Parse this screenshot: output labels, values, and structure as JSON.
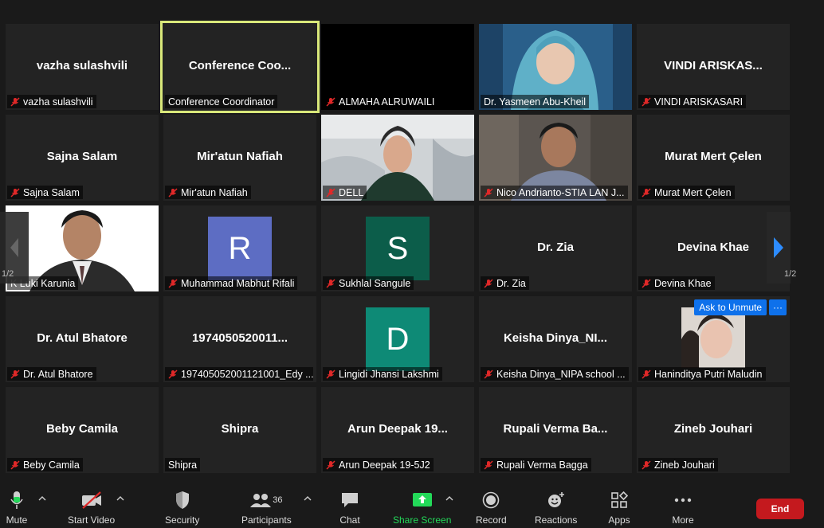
{
  "participants": [
    {
      "display": "vazha  sulashvili",
      "tag": "vazha  sulashvili",
      "muted": true
    },
    {
      "display": "Conference  Coo...",
      "tag": "Conference Coordinator",
      "muted": false
    },
    {
      "display": "",
      "tag": "ALMAHA ALRUWAILI",
      "muted": true
    },
    {
      "display": "",
      "tag": "Dr. Yasmeen Abu-Kheil",
      "muted": false
    },
    {
      "display": "VINDI  ARISKAS...",
      "tag": "VINDI ARISKASARI",
      "muted": true
    },
    {
      "display": "Sajna Salam",
      "tag": "Sajna Salam",
      "muted": true
    },
    {
      "display": "Mir'atun Nafiah",
      "tag": "Mir'atun Nafiah",
      "muted": true
    },
    {
      "display": "",
      "tag": "DELL",
      "muted": true
    },
    {
      "display": "",
      "tag": "Nico Andrianto-STIA LAN J...",
      "muted": true
    },
    {
      "display": "Murat Mert Çelen",
      "tag": "Murat Mert Çelen",
      "muted": true
    },
    {
      "display": "",
      "tag": "K Luki Karunia",
      "muted": false
    },
    {
      "display": "",
      "tag": "Muhammad Mabhut Rifali",
      "muted": true,
      "avatar": "R"
    },
    {
      "display": "",
      "tag": "Sukhlal Sangule",
      "muted": true,
      "avatar": "S"
    },
    {
      "display": "Dr. Zia",
      "tag": "Dr. Zia",
      "muted": true
    },
    {
      "display": "Devina Khae",
      "tag": "Devina Khae",
      "muted": true
    },
    {
      "display": "Dr. Atul Bhatore",
      "tag": "Dr. Atul Bhatore",
      "muted": true
    },
    {
      "display": "1974050520011...",
      "tag": "197405052001121001_Edy ...",
      "muted": true
    },
    {
      "display": "",
      "tag": "Lingidi Jhansi Lakshmi",
      "muted": true,
      "avatar": "D"
    },
    {
      "display": "Keisha  Dinya_NI...",
      "tag": "Keisha Dinya_NIPA school ...",
      "muted": true
    },
    {
      "display": "",
      "tag": "Haninditya Putri Maludin",
      "muted": true
    },
    {
      "display": "Beby Camila",
      "tag": "Beby Camila",
      "muted": true
    },
    {
      "display": "Shipra",
      "tag": "Shipra",
      "muted": false
    },
    {
      "display": "Arun  Deepak 19...",
      "tag": "Arun Deepak 19-5J2",
      "muted": true
    },
    {
      "display": "Rupali  Verma  Ba...",
      "tag": "Rupali Verma Bagga",
      "muted": true
    },
    {
      "display": "Zineb Jouhari",
      "tag": "Zineb Jouhari",
      "muted": true
    }
  ],
  "avatar_colors": {
    "R": "#5d6dc3",
    "S": "#0c5d4a",
    "D": "#0e8a76"
  },
  "pager": {
    "left": "1/2",
    "right": "1/2"
  },
  "hover": {
    "unmute": "Ask to Unmute",
    "more": "···"
  },
  "toolbar": {
    "mute": "Mute",
    "video": "Start Video",
    "security": "Security",
    "participants": "Participants",
    "participants_count": "36",
    "chat": "Chat",
    "share": "Share Screen",
    "record": "Record",
    "reactions": "Reactions",
    "apps": "Apps",
    "more": "More",
    "end": "End"
  },
  "colors": {
    "accent": "#0e71eb",
    "share_green": "#23d959",
    "end_red": "#c4191e",
    "active_border": "#d9e87a"
  }
}
